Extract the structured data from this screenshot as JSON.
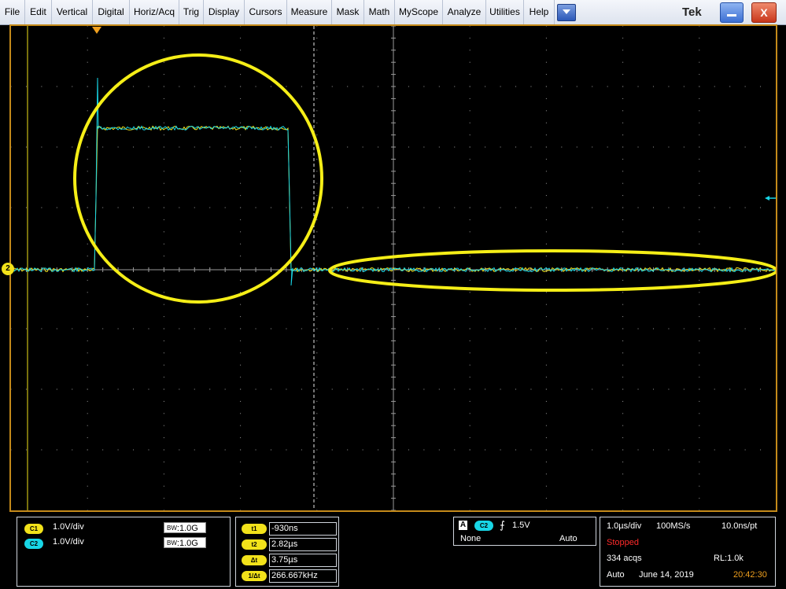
{
  "menu": {
    "items": [
      "File",
      "Edit",
      "Vertical",
      "Digital",
      "Horiz/Acq",
      "Trig",
      "Display",
      "Cursors",
      "Measure",
      "Mask",
      "Math",
      "MyScope",
      "Analyze",
      "Utilities",
      "Help"
    ],
    "logo": "Tek",
    "close_label": "X"
  },
  "display": {
    "channel_marker": "2",
    "trace_color_ch1": "#f2e21a",
    "trace_color_ch2": "#18d6e6",
    "annotation_color": "#f5ee17",
    "grid_color": "#9a9a9a",
    "frame_color": "#c48a1a"
  },
  "vertical": {
    "ch1": {
      "chip": "C1",
      "scale": "1.0V/div",
      "bw_prefix": "B",
      "bw_sub": "W",
      "bw_value": ":1.0G"
    },
    "ch2": {
      "chip": "C2",
      "scale": "1.0V/div",
      "bw_prefix": "B",
      "bw_sub": "W",
      "bw_value": ":1.0G"
    }
  },
  "cursors": {
    "rows": [
      {
        "label": "t1",
        "value": "-930ns"
      },
      {
        "label": "t2",
        "value": "2.82µs"
      },
      {
        "label": "Δt",
        "value": "3.75µs"
      },
      {
        "label": "1/Δt",
        "value": "266.667kHz"
      }
    ]
  },
  "trigger": {
    "a_label": "A",
    "source": "C2",
    "slope_symbol": "⨍",
    "level": "1.5V",
    "coupling": "None",
    "mode": "Auto"
  },
  "acquisition": {
    "time_div": "1.0µs/div",
    "sample_rate": "100MS/s",
    "ns_per_pt": "10.0ns/pt",
    "status": "Stopped",
    "acqs": "334 acqs",
    "record_length": "RL:1.0k",
    "mode": "Auto",
    "date": "June 14, 2019",
    "time": "20:42:30"
  }
}
